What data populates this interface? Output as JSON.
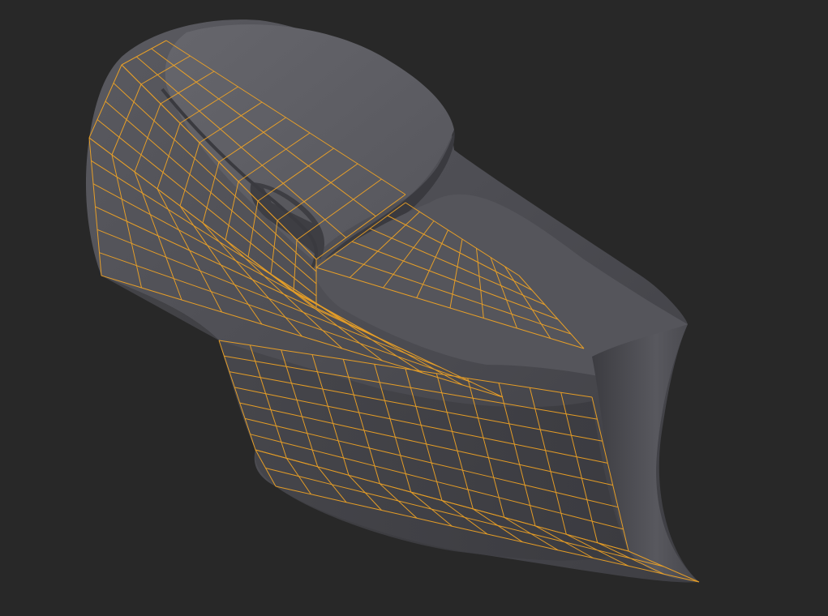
{
  "viewport": {
    "background_color": "#282828",
    "mesh_color": "#505055",
    "mesh_shadow_color": "#3a3a3e",
    "mesh_highlight_color": "#6a6a70",
    "wireframe_color": "#f5a623"
  }
}
